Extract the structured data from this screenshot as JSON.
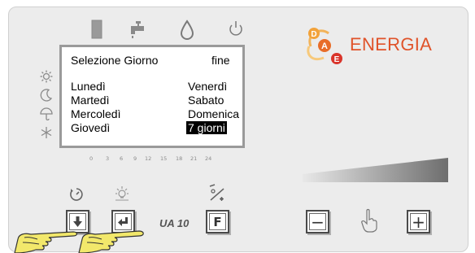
{
  "display": {
    "title": "Selezione Giorno",
    "action": "fine",
    "days_left": [
      "Lunedì",
      "Martedì",
      "Mercoledì",
      "Giovedì"
    ],
    "days_right": [
      "Venerdì",
      "Sabato",
      "Domenica",
      "7 giorni"
    ],
    "selected": "7 giorni"
  },
  "time_scale": [
    "0",
    "3",
    "6",
    "9",
    "12",
    "15",
    "18",
    "21",
    "24"
  ],
  "brand": {
    "name": "ENERGIA",
    "letters": [
      "D",
      "A",
      "E"
    ],
    "color": "#e0532a"
  },
  "model": "UA 10",
  "buttons": {
    "f_label": "F",
    "minus_label": "−",
    "plus_label": "+"
  },
  "icons": {
    "top": [
      "heater-icon",
      "faucet-icon",
      "drop-icon",
      "power-icon"
    ],
    "side": [
      "sun-icon",
      "moon-icon",
      "umbrella-icon",
      "snowflake-icon"
    ],
    "above_buttons": [
      "timer-icon",
      "lamp-icon",
      "percent-icon"
    ],
    "pointer": "pointing-hand-icon"
  }
}
